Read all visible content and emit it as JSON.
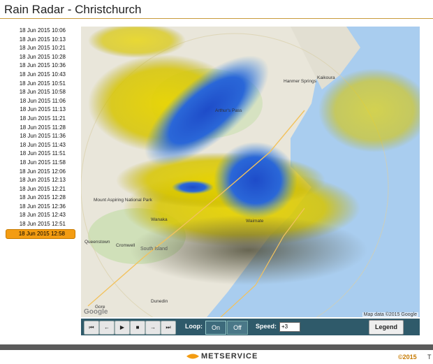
{
  "page": {
    "title": "Rain Radar - Christchurch"
  },
  "timestamps": [
    "18 Jun 2015 10:06",
    "18 Jun 2015 10:13",
    "18 Jun 2015 10:21",
    "18 Jun 2015 10:28",
    "18 Jun 2015 10:36",
    "18 Jun 2015 10:43",
    "18 Jun 2015 10:51",
    "18 Jun 2015 10:58",
    "18 Jun 2015 11:06",
    "18 Jun 2015 11:13",
    "18 Jun 2015 11:21",
    "18 Jun 2015 11:28",
    "18 Jun 2015 11:36",
    "18 Jun 2015 11:43",
    "18 Jun 2015 11:51",
    "18 Jun 2015 11:58",
    "18 Jun 2015 12:06",
    "18 Jun 2015 12:13",
    "18 Jun 2015 12:21",
    "18 Jun 2015 12:28",
    "18 Jun 2015 12:36",
    "18 Jun 2015 12:43",
    "18 Jun 2015 12:51",
    "18 Jun 2015 12:58"
  ],
  "selected_index": 23,
  "map": {
    "attribution": "Map data ©2015 Google",
    "google_logo": "Google",
    "places": {
      "hanmer": "Hanmer Springs",
      "kaikoura": "Kaikoura",
      "arthurs_pass": "Arthur's Pass",
      "mount_aspiring": "Mount Aspiring National Park",
      "wanaka": "Wanaka",
      "queenstown": "Queenstown",
      "cromwell": "Cromwell",
      "south_island": "South Island",
      "gore": "Gore",
      "dunedin": "Dunedin",
      "waimate": "Waimate"
    }
  },
  "controls": {
    "first_icon": "skip-first-icon",
    "prev_icon": "step-back-icon",
    "play_icon": "play-icon",
    "stop_icon": "stop-icon",
    "next_icon": "step-forward-icon",
    "last_icon": "skip-last-icon",
    "loop_label": "Loop:",
    "loop_on": "On",
    "loop_off": "Off",
    "speed_label": "Speed:",
    "speed_value": "+3",
    "legend_label": "Legend"
  },
  "footer": {
    "brand": "METSERVICE",
    "copyright": "©2015",
    "trailing": "T"
  },
  "colors": {
    "accent": "#f39c12",
    "control_bar": "#2f5a6a",
    "title_rule": "#c89a3a"
  }
}
